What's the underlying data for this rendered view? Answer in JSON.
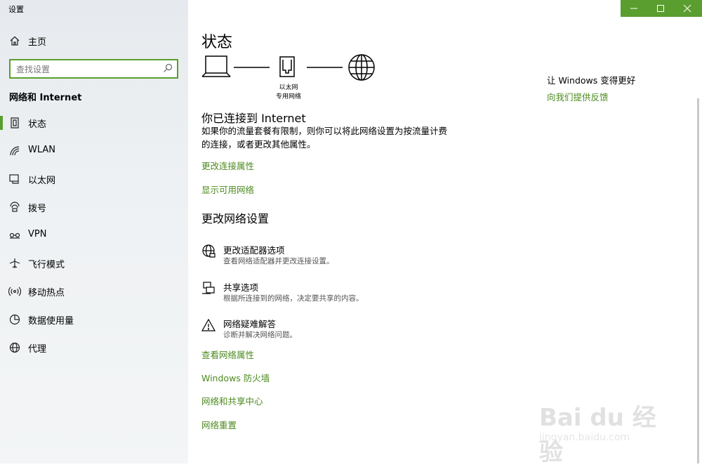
{
  "app": {
    "title": "设置"
  },
  "window_controls": {
    "minimize": "—",
    "maximize": "☐",
    "close": "✕"
  },
  "sidebar": {
    "home": {
      "label": "主页",
      "icon": "home-icon"
    },
    "search": {
      "placeholder": "查找设置"
    },
    "section_heading": "网络和 Internet",
    "items": [
      {
        "label": "状态",
        "icon": "status-icon"
      },
      {
        "label": "WLAN",
        "icon": "wifi-icon"
      },
      {
        "label": "以太网",
        "icon": "ethernet-icon"
      },
      {
        "label": "拨号",
        "icon": "dialup-icon"
      },
      {
        "label": "VPN",
        "icon": "vpn-icon"
      },
      {
        "label": "飞行模式",
        "icon": "airplane-icon"
      },
      {
        "label": "移动热点",
        "icon": "hotspot-icon"
      },
      {
        "label": "数据使用量",
        "icon": "data-usage-icon"
      },
      {
        "label": "代理",
        "icon": "globe-icon"
      }
    ],
    "selected": "状态"
  },
  "main": {
    "title": "状态",
    "diagram": {
      "line1": "以太网",
      "line2": "专用网络"
    },
    "connected_title": "你已连接到 Internet",
    "connected_desc": "如果你的流量套餐有限制，则你可以将此网络设置为按流量计费的连接，或者更改其他属性。",
    "links_top": [
      "更改连接属性",
      "显示可用网络"
    ],
    "change_settings_title": "更改网络设置",
    "options": [
      {
        "title": "更改适配器选项",
        "desc": "查看网络适配器并更改连接设置。",
        "icon": "adapter-globe-icon"
      },
      {
        "title": "共享选项",
        "desc": "根据所连接到的网络，决定要共享的内容。",
        "icon": "sharing-icon"
      },
      {
        "title": "网络疑难解答",
        "desc": "诊断并解决网络问题。",
        "icon": "warning-icon"
      }
    ],
    "links_bottom": [
      "查看网络属性",
      "Windows 防火墙",
      "网络和共享中心",
      "网络重置"
    ]
  },
  "feedback": {
    "heading": "让 Windows 变得更好",
    "link": "向我们提供反馈"
  },
  "watermark": {
    "text": "Bai du 经验",
    "url": "jingyan.baidu.com"
  },
  "colors": {
    "accent": "#5a9e2f",
    "link": "#4c8a1e"
  }
}
